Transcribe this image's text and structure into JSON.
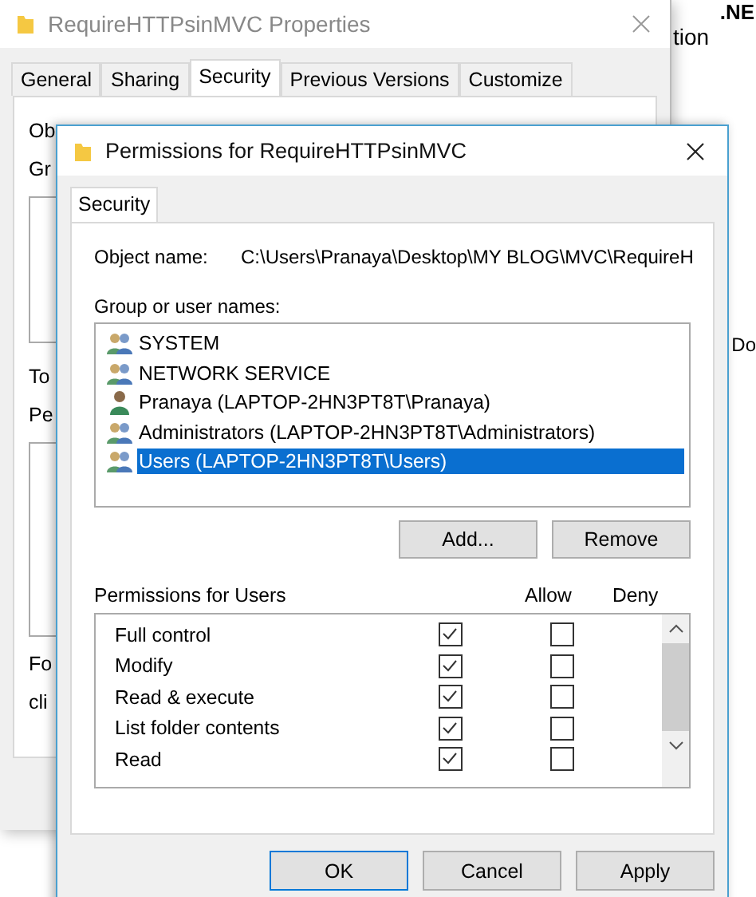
{
  "desktop_fragments": [
    {
      "text": ".NE",
      "bold": true
    },
    {
      "text": "tion",
      "bold": false
    },
    {
      "text": "Do",
      "bold": false
    }
  ],
  "background_window": {
    "title": "RequireHTTPsinMVC Properties",
    "tabs": [
      {
        "label": "General",
        "selected": false
      },
      {
        "label": "Sharing",
        "selected": false
      },
      {
        "label": "Security",
        "selected": true
      },
      {
        "label": "Previous Versions",
        "selected": false
      },
      {
        "label": "Customize",
        "selected": false
      }
    ],
    "items": [
      {
        "kind": "label",
        "text": "Ob"
      },
      {
        "kind": "label",
        "text": "Gr"
      },
      {
        "kind": "listbox"
      },
      {
        "kind": "label",
        "text": "To"
      },
      {
        "kind": "label",
        "text": "Pe"
      },
      {
        "kind": "box"
      },
      {
        "kind": "label",
        "text": "Fo"
      },
      {
        "kind": "label",
        "text": "cli"
      }
    ]
  },
  "dialog": {
    "title": "Permissions for RequireHTTPsinMVC",
    "tabs": [
      {
        "label": "Security",
        "selected": true
      }
    ],
    "object_name_label": "Object name:",
    "object_name": "C:\\Users\\Pranaya\\Desktop\\MY BLOG\\MVC\\RequireH",
    "group_label": "Group or user names:",
    "principals": [
      {
        "name": "SYSTEM",
        "kind": "group",
        "selected": false
      },
      {
        "name": "NETWORK SERVICE",
        "kind": "group",
        "selected": false
      },
      {
        "name": "Pranaya (LAPTOP-2HN3PT8T\\Pranaya)",
        "kind": "user",
        "selected": false
      },
      {
        "name": "Administrators (LAPTOP-2HN3PT8T\\Administrators)",
        "kind": "group",
        "selected": false
      },
      {
        "name": "Users (LAPTOP-2HN3PT8T\\Users)",
        "kind": "group",
        "selected": true
      }
    ],
    "list_buttons": [
      "Add...",
      "Remove"
    ],
    "permissions_label": "Permissions for Users",
    "allow_label": "Allow",
    "deny_label": "Deny",
    "permissions": [
      {
        "name": "Full control",
        "allow": true,
        "deny": false
      },
      {
        "name": "Modify",
        "allow": true,
        "deny": false
      },
      {
        "name": "Read & execute",
        "allow": true,
        "deny": false
      },
      {
        "name": "List folder contents",
        "allow": true,
        "deny": false
      },
      {
        "name": "Read",
        "allow": true,
        "deny": false
      }
    ],
    "buttons": [
      {
        "label": "OK",
        "default": true
      },
      {
        "label": "Cancel",
        "default": false
      },
      {
        "label": "Apply",
        "default": false
      }
    ]
  }
}
